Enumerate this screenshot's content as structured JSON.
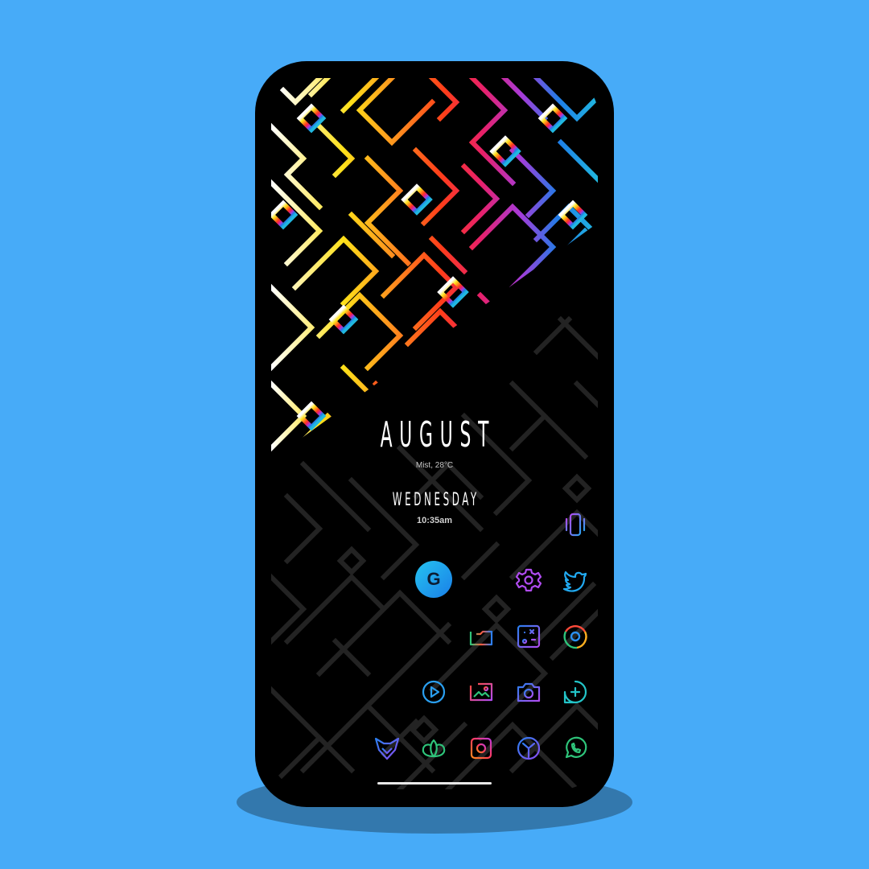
{
  "widget": {
    "month": "AUGUST",
    "weather": "Mist, 28°C",
    "day": "WEDNESDAY",
    "time": "10:35am"
  },
  "search": {
    "label": "G"
  },
  "icons": [
    "phone-vibrate-icon",
    "settings-gear-icon",
    "twitter-bird-icon",
    "files-icon",
    "gallery-icon",
    "chrome-icon",
    "play-icon",
    "photo-icon",
    "camera-icon",
    "add-message-icon",
    "fox-app-icon",
    "lotus-icon",
    "instagram-icon",
    "clock-icon",
    "whatsapp-icon"
  ],
  "colors": {
    "background": "#47abf8",
    "accent_cyan": "#25c3f0",
    "accent_blue": "#1a7fe8",
    "maze_dark": "#232323"
  }
}
